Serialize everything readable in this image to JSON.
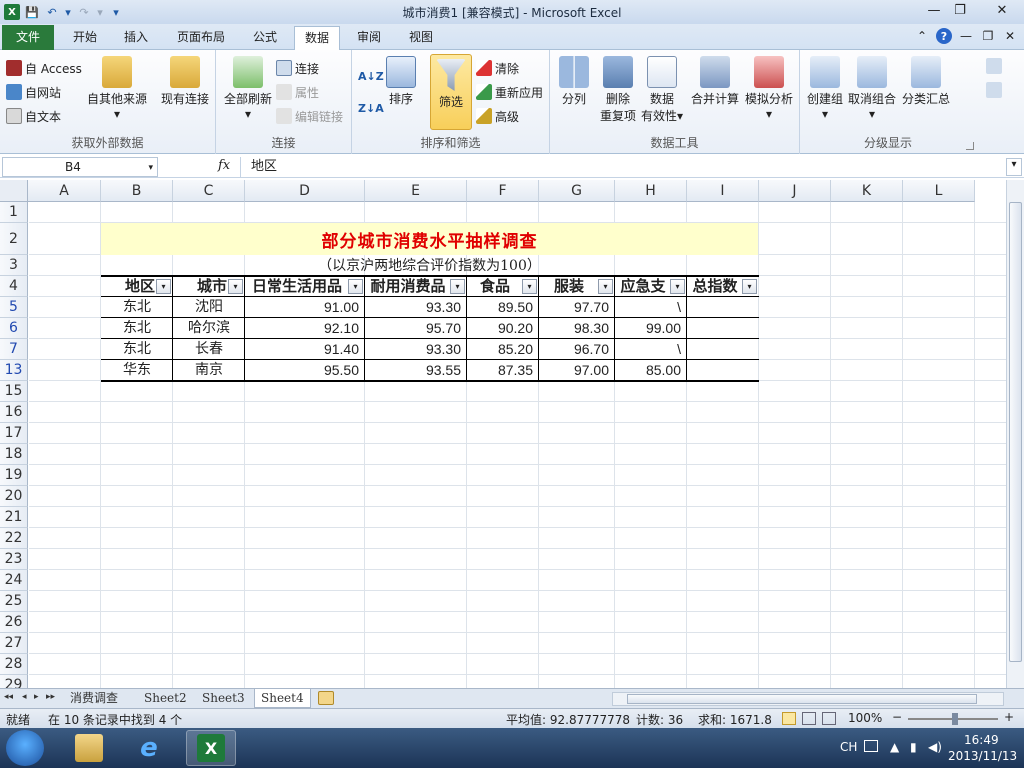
{
  "window": {
    "title": "城市消费1 [兼容模式] - Microsoft Excel",
    "minimize": "—",
    "restore": "❐",
    "close": "✕"
  },
  "qat": {
    "save": "💾",
    "undo": "↶",
    "undo_dd": "▾",
    "redo": "↷",
    "redo_dd": "▾",
    "customize": "▾"
  },
  "tabs": {
    "file": "文件",
    "home": "开始",
    "insert": "插入",
    "layout": "页面布局",
    "formulas": "公式",
    "data": "数据",
    "review": "审阅",
    "view": "视图"
  },
  "tab_icons": {
    "collapse": "⌃",
    "help": "?",
    "min": "—",
    "restore": "❐",
    "close": "✕"
  },
  "ribbon": {
    "external": {
      "label": "获取外部数据",
      "access": "自 Access",
      "web": "自网站",
      "text": "自文本",
      "other_sources": "自其他来源",
      "other_dd": "▾",
      "existing": "现有连接"
    },
    "connections": {
      "label": "连接",
      "refresh_all": "全部刷新",
      "refresh_dd": "▾",
      "connections": "连接",
      "properties": "属性",
      "edit_links": "编辑链接"
    },
    "sort_filter": {
      "label": "排序和筛选",
      "sort_az": "A↓Z",
      "sort_za": "Z↓A",
      "sort": "排序",
      "filter": "筛选",
      "clear": "清除",
      "reapply": "重新应用",
      "advanced": "高级"
    },
    "data_tools": {
      "label": "数据工具",
      "split": "分列",
      "remove_dup_1": "删除",
      "remove_dup_2": "重复项",
      "validation_1": "数据",
      "validation_2": "有效性",
      "validation_dd": "▾",
      "consolidate": "合并计算",
      "whatif": "模拟分析",
      "whatif_dd": "▾"
    },
    "outline": {
      "label": "分级显示",
      "group": "创建组",
      "ungroup": "取消组合",
      "subtotal": "分类汇总",
      "group_dd": "▾",
      "ungroup_dd": "▾"
    }
  },
  "formula_bar": {
    "name_box": "B4",
    "name_dd": "▾",
    "fx": "fx",
    "content": "地区",
    "expand": "▾"
  },
  "columns": [
    "A",
    "B",
    "C",
    "D",
    "E",
    "F",
    "G",
    "H",
    "I",
    "J",
    "K",
    "L"
  ],
  "rows": [
    "1",
    "2",
    "3",
    "4",
    "5",
    "6",
    "7",
    "13",
    "15",
    "16",
    "17",
    "18",
    "19",
    "20",
    "21",
    "22",
    "23",
    "24",
    "25",
    "26",
    "27",
    "28",
    "29"
  ],
  "sheet": {
    "title": "部分城市消费水平抽样调查",
    "subtitle": "（以京沪两地综合评价指数为100）",
    "headers": [
      "地区",
      "城市",
      "日常生活用品",
      "耐用消费品",
      "食品",
      "服装",
      "应急支",
      "总指数"
    ],
    "filter_glyphs": [
      "▾",
      "▾",
      "▾",
      "▾",
      "▾",
      "▾",
      "▾",
      "▾"
    ],
    "data": [
      [
        "东北",
        "沈阳",
        "91.00",
        "93.30",
        "89.50",
        "97.70",
        "\\",
        ""
      ],
      [
        "东北",
        "哈尔滨",
        "92.10",
        "95.70",
        "90.20",
        "98.30",
        "99.00",
        ""
      ],
      [
        "东北",
        "长春",
        "91.40",
        "93.30",
        "85.20",
        "96.70",
        "\\",
        ""
      ],
      [
        "华东",
        "南京",
        "95.50",
        "93.55",
        "87.35",
        "97.00",
        "85.00",
        ""
      ]
    ]
  },
  "sheet_tabs": [
    "消费调查",
    "Sheet2",
    "Sheet3",
    "Sheet4"
  ],
  "sheet_nav": [
    "◂◂",
    "◂",
    "▸",
    "▸▸"
  ],
  "active_sheet": "Sheet4",
  "status": {
    "ready": "就绪",
    "filter_msg": "在 10 条记录中找到 4 个",
    "average": "平均值: 92.87777778",
    "count": "计数: 36",
    "sum": "求和: 1671.8",
    "zoom": "100%",
    "zoom_minus": "−",
    "zoom_plus": "+"
  },
  "taskbar": {
    "lang": "CH",
    "time": "16:49",
    "date": "2013/11/13"
  },
  "colors": {
    "title_red": "#e00000",
    "title_band": "#ffffcc",
    "file_tab": "#2a7a3b",
    "filtered_row": "#2149b0"
  }
}
